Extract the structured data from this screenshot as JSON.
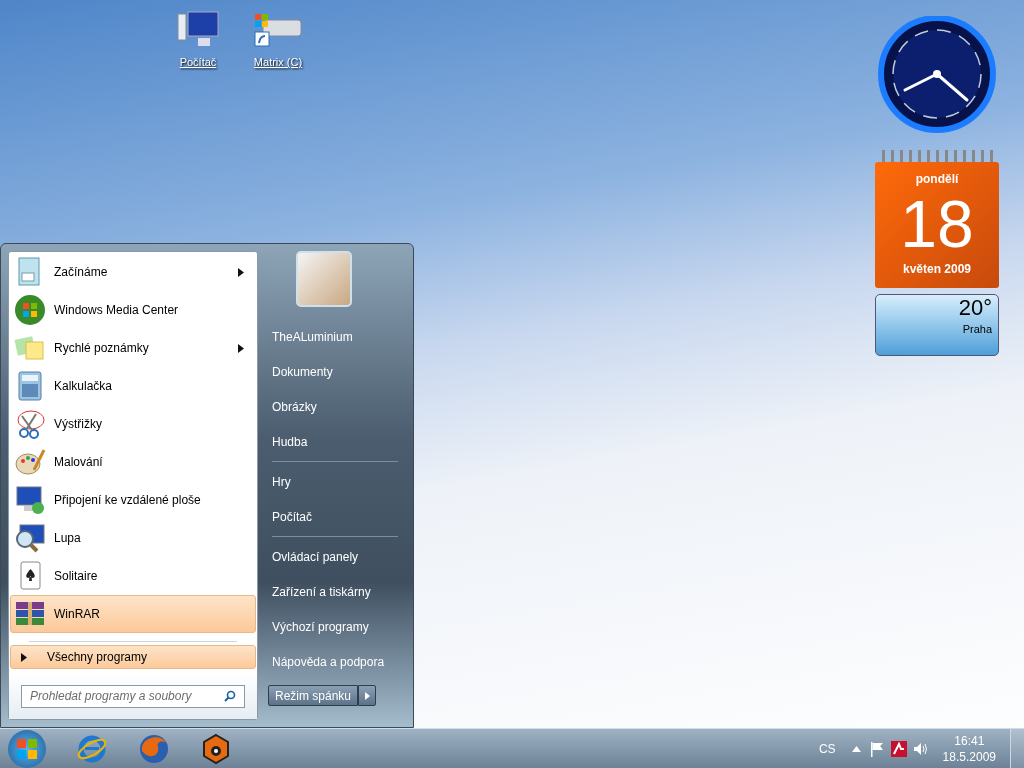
{
  "desktop_icons": [
    {
      "label": "Počítač"
    },
    {
      "label": "Matrix (C)"
    }
  ],
  "gadgets": {
    "calendar": {
      "weekday": "pondělí",
      "day": "18",
      "month_year": "květen 2009"
    },
    "weather": {
      "temperature": "20°",
      "city": "Praha"
    }
  },
  "start_menu": {
    "programs": [
      {
        "label": "Začínáme",
        "submenu": true,
        "selected": false
      },
      {
        "label": "Windows Media Center",
        "submenu": false,
        "selected": false
      },
      {
        "label": "Rychlé poznámky",
        "submenu": true,
        "selected": false
      },
      {
        "label": "Kalkulačka",
        "submenu": false,
        "selected": false
      },
      {
        "label": "Výstřižky",
        "submenu": false,
        "selected": false
      },
      {
        "label": "Malování",
        "submenu": false,
        "selected": false
      },
      {
        "label": "Připojení ke vzdálené ploše",
        "submenu": false,
        "selected": false
      },
      {
        "label": "Lupa",
        "submenu": false,
        "selected": false
      },
      {
        "label": "Solitaire",
        "submenu": false,
        "selected": false
      },
      {
        "label": "WinRAR",
        "submenu": false,
        "selected": true
      }
    ],
    "all_programs": {
      "label": "Všechny programy",
      "selected": true
    },
    "search": {
      "placeholder": "Prohledat programy a soubory"
    },
    "place_groups": [
      {
        "items": [
          "TheALuminium",
          "Dokumenty",
          "Obrázky",
          "Hudba"
        ]
      },
      {
        "items": [
          "Hry",
          "Počítač"
        ]
      },
      {
        "items": [
          "Ovládací panely",
          "Zařízení a tiskárny",
          "Výchozí programy",
          "Nápověda a podpora"
        ]
      }
    ],
    "shutdown": {
      "label": "Režim spánku"
    }
  },
  "taskbar": {
    "tray": {
      "language": "CS",
      "time": "16:41",
      "date": "18.5.2009"
    }
  }
}
